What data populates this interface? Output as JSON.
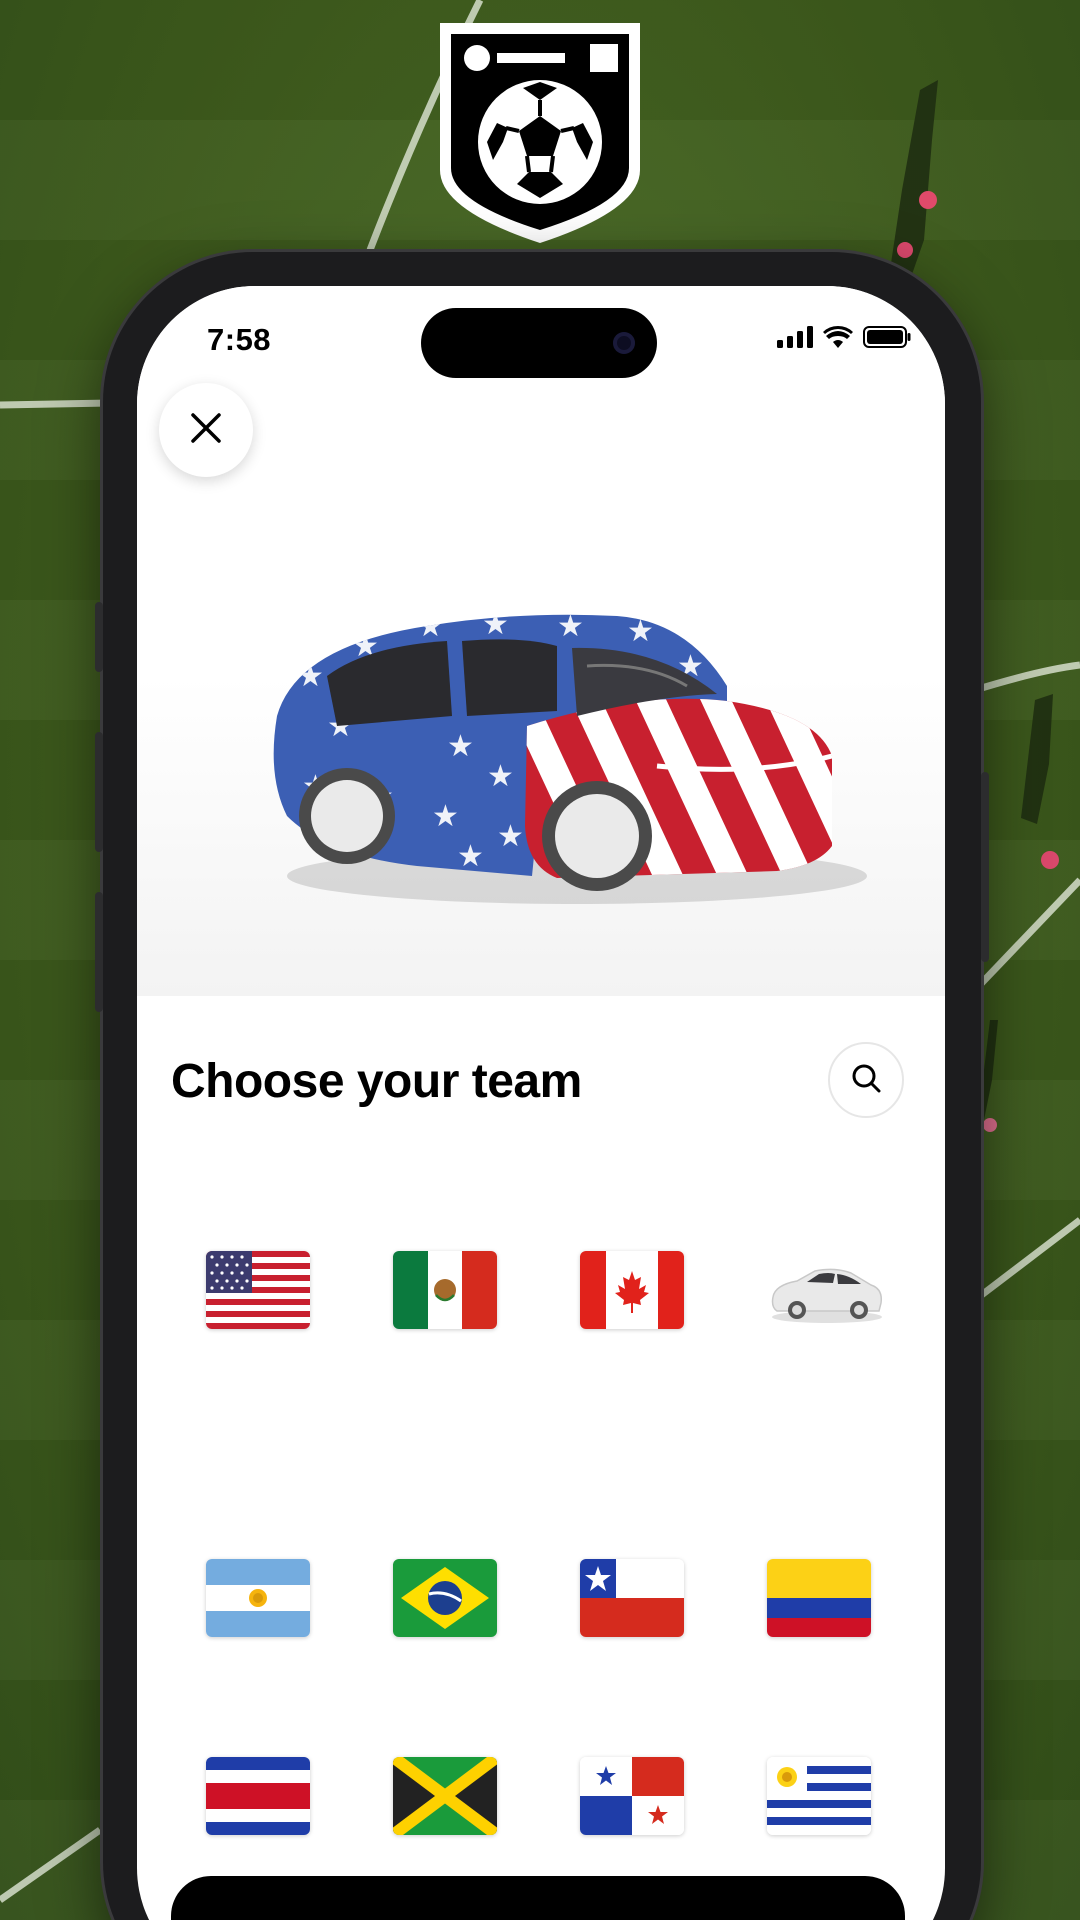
{
  "status_bar": {
    "time": "7:58"
  },
  "header": {
    "close_icon": "close-icon"
  },
  "hero": {
    "vehicle": "car-with-usa-flag-wrap"
  },
  "team_picker": {
    "title": "Choose your team",
    "search_icon": "search-icon",
    "teams": [
      {
        "flag": "usa"
      },
      {
        "flag": "mexico"
      },
      {
        "flag": "canada"
      },
      {
        "flag": "default-car"
      },
      {
        "flag": "argentina"
      },
      {
        "flag": "brazil"
      },
      {
        "flag": "chile"
      },
      {
        "flag": "colombia"
      },
      {
        "flag": "costa-rica"
      },
      {
        "flag": "jamaica"
      },
      {
        "flag": "panama"
      },
      {
        "flag": "uruguay"
      }
    ]
  },
  "colors": {
    "usa_blue": "#3c5fb4",
    "usa_red": "#c8202f",
    "primary_button": "#000000"
  }
}
